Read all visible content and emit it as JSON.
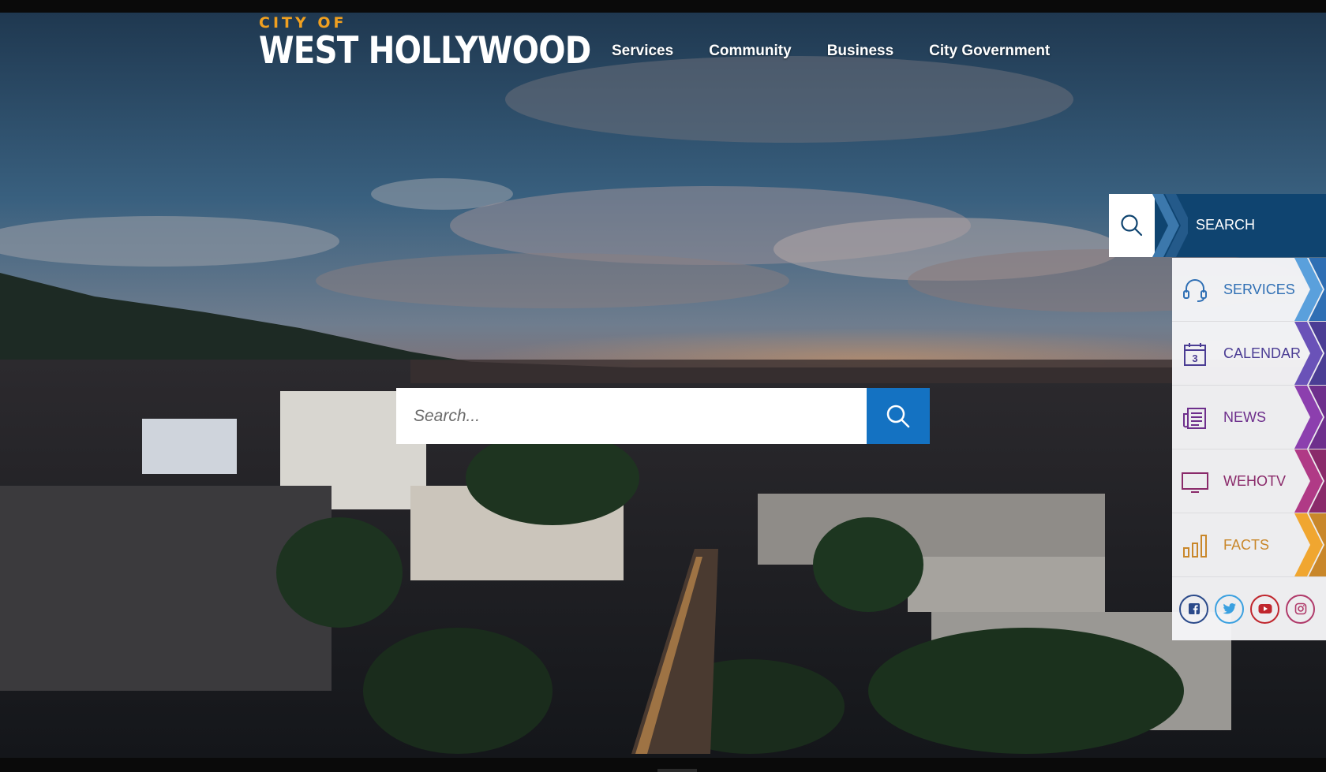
{
  "header": {
    "logo_top": "CITY OF",
    "logo_main": "WEST HOLLYWOOD"
  },
  "nav": {
    "items": [
      {
        "label": "Services"
      },
      {
        "label": "Community"
      },
      {
        "label": "Business"
      },
      {
        "label": "City Government"
      }
    ]
  },
  "search": {
    "placeholder": "Search...",
    "button_icon": "search-icon"
  },
  "sidebar": {
    "search_label": "SEARCH",
    "items": [
      {
        "label": "SERVICES",
        "icon": "headset-icon",
        "color": "#2f6fb4",
        "accent": "#5aa0dc"
      },
      {
        "label": "CALENDAR",
        "icon": "calendar-icon",
        "calendar_day": "3",
        "color": "#4b3d94",
        "accent": "#6a52b8"
      },
      {
        "label": "NEWS",
        "icon": "newspaper-icon",
        "color": "#6e2f8c",
        "accent": "#8c3fae"
      },
      {
        "label": "WEHOTV",
        "icon": "tv-icon",
        "color": "#8a2a6a",
        "accent": "#b03a86"
      },
      {
        "label": "FACTS",
        "icon": "bar-chart-icon",
        "color": "#c9872a",
        "accent": "#f0a630"
      }
    ],
    "social": [
      {
        "name": "facebook-icon",
        "color": "#2b4a8a"
      },
      {
        "name": "twitter-icon",
        "color": "#3aa0e0"
      },
      {
        "name": "youtube-icon",
        "color": "#c0262d"
      },
      {
        "name": "instagram-icon",
        "color": "#b03a6a"
      }
    ]
  }
}
